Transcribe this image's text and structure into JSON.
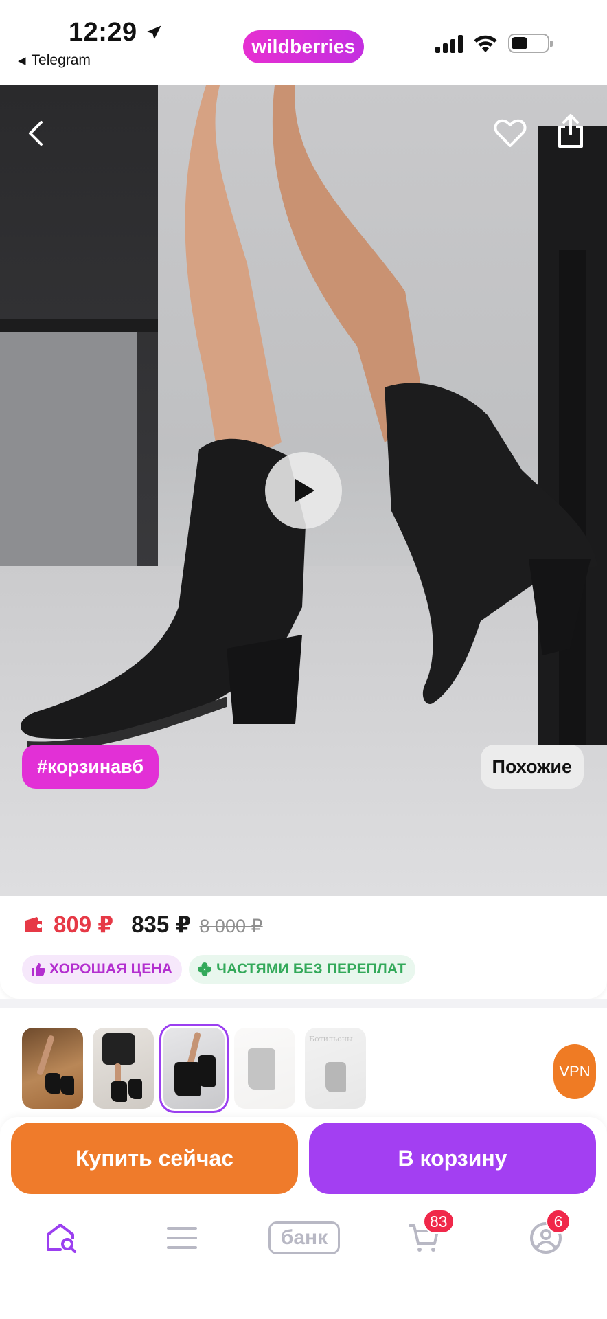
{
  "status_bar": {
    "time": "12:29",
    "back_app": "Telegram",
    "brand": "wildberries",
    "battery_level": 0.45
  },
  "product": {
    "hashtag": "#корзинавб",
    "similar_label": "Похожие",
    "video_available": true
  },
  "pricing": {
    "wallet_price": "809 ₽",
    "price": "835 ₽",
    "old_price": "8 000 ₽",
    "badges": [
      {
        "label": "ХОРОШАЯ ЦЕНА",
        "icon": "thumbs-up-icon",
        "color": "#b32fcf"
      },
      {
        "label": "ЧАСТЯМИ БЕЗ ПЕРЕПЛАТ",
        "icon": "clover-icon",
        "color": "#33a95a"
      }
    ]
  },
  "gallery": {
    "thumbnails": [
      {
        "name": "thumb-1",
        "active": false
      },
      {
        "name": "thumb-2",
        "active": false
      },
      {
        "name": "thumb-3",
        "active": true
      },
      {
        "name": "thumb-4",
        "active": false
      },
      {
        "name": "thumb-5",
        "active": false
      }
    ],
    "thumb5_caption": "Ботильоны"
  },
  "vpn_label": "VPN",
  "actions": {
    "buy_now": "Купить сейчас",
    "add_to_cart": "В корзину"
  },
  "tabbar": {
    "bank_label": "банк",
    "cart_count": "83",
    "profile_count": "6"
  },
  "colors": {
    "brand": "#cb2ee0",
    "buy": "#ef7b2b",
    "cart": "#a33ff2",
    "wallet_price": "#e63946",
    "counter": "#f0284a"
  }
}
